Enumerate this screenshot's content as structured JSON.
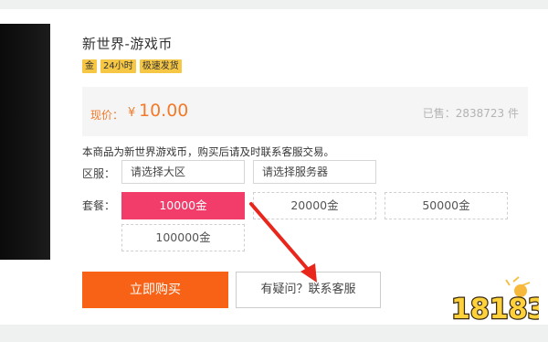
{
  "product": {
    "title": "新世界-游戏币",
    "tags": [
      "金",
      "24小时",
      "极速发货"
    ],
    "price_label": "现价：",
    "price_currency": "¥",
    "price_value": "10.00",
    "sold": "已售：2838723 件",
    "description": "本商品为新世界游戏币，购买后请及时联系客服交易。"
  },
  "server": {
    "label": "区服：",
    "region_placeholder": "请选择大区",
    "server_placeholder": "请选择服务器"
  },
  "packages": {
    "label": "套餐：",
    "items": [
      "10000金",
      "20000金",
      "50000金",
      "100000金"
    ],
    "selected_index": 0
  },
  "actions": {
    "buy_label": "立即购买",
    "contact_label": "有疑问？联系客服"
  },
  "watermark": {
    "text": "18183"
  },
  "colors": {
    "accent_orange": "#f76216",
    "price_orange": "#f27a2a",
    "package_selected": "#f23d6b",
    "tag_yellow": "#f6c645",
    "arrow_red": "#e8261c"
  }
}
